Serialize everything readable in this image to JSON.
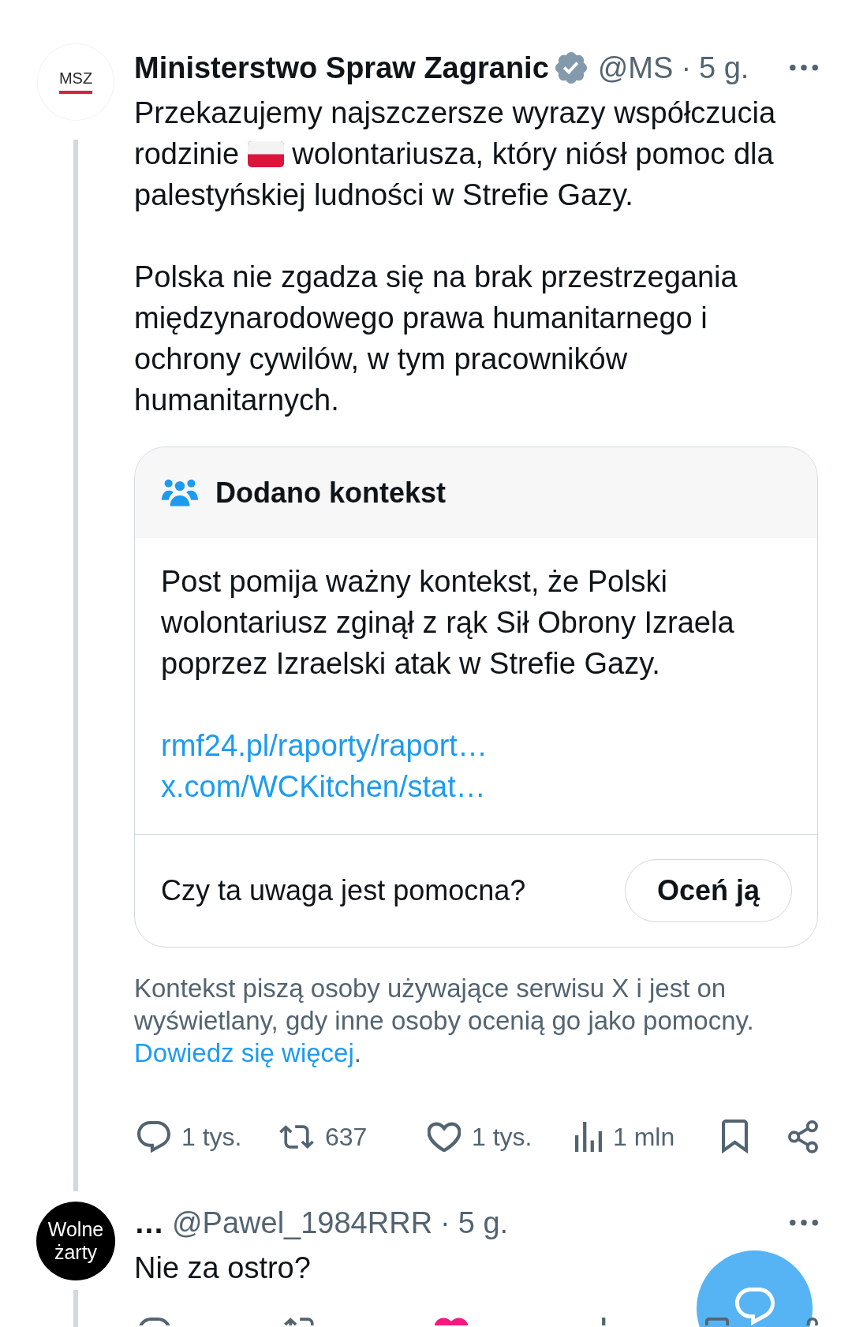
{
  "post": {
    "avatar": {
      "label": "MSZ"
    },
    "author": {
      "name": "Ministerstwo Spraw Zagranic",
      "verified": true,
      "handle": "@MS",
      "separator": "·",
      "time": "5 g."
    },
    "paragraphs": [
      {
        "parts": [
          {
            "kind": "text",
            "text": "Przekazujemy najszczersze wyrazy współczucia rodzinie"
          },
          {
            "kind": "emoji"
          },
          {
            "kind": "text",
            "text": "wolontariusza, który niósł pomoc dla palestyńskiej ludności w Strefie Gazy."
          }
        ]
      },
      {
        "parts": [
          {
            "kind": "text",
            "text": "Polska nie zgadza się na brak przestrzegania międzynarodowego prawa humanitarnego i ochrony cywilów, w tym pracowników humanitarnych."
          }
        ]
      }
    ],
    "context_note": {
      "title": "Dodano kontekst",
      "text": "Post pomija ważny kontekst, że Polski wolontariusz zginął z rąk Sił Obrony Izraela poprzez Izraelski atak w Strefie Gazy.",
      "links": [
        "rmf24.pl/raporty/raport…",
        "x.com/WCKitchen/stat…"
      ],
      "question": "Czy ta uwaga jest pomocna?",
      "rate_button": "Oceń ją"
    },
    "note_disclaimer": {
      "text": "Kontekst piszą osoby używające serwisu X i jest on wyświetlany, gdy inne osoby ocenią go jako pomocny.",
      "link": "Dowiedz się więcej",
      "end": "."
    },
    "actions": [
      {
        "kind": "reply",
        "count": "1 tys.",
        "active": false
      },
      {
        "kind": "repost",
        "count": "637",
        "active": false
      },
      {
        "kind": "like",
        "count": "1 tys.",
        "active": false
      },
      {
        "kind": "views",
        "count": "1 mln",
        "active": false
      },
      {
        "kind": "bookmark",
        "active": false
      },
      {
        "kind": "share",
        "active": false
      }
    ]
  },
  "reply": {
    "avatar": {
      "label": "Wolne żarty"
    },
    "author": {
      "name": "…",
      "handle": "@Pawel_1984RRR",
      "separator": "·",
      "time": "5 g."
    },
    "text": "Nie za ostro?",
    "actions": [
      {
        "kind": "reply",
        "active": false
      },
      {
        "kind": "repost",
        "active": false
      },
      {
        "kind": "like",
        "active": true
      },
      {
        "kind": "views",
        "active": false
      },
      {
        "kind": "bookmark",
        "active": false
      },
      {
        "kind": "share",
        "active": false
      }
    ]
  }
}
